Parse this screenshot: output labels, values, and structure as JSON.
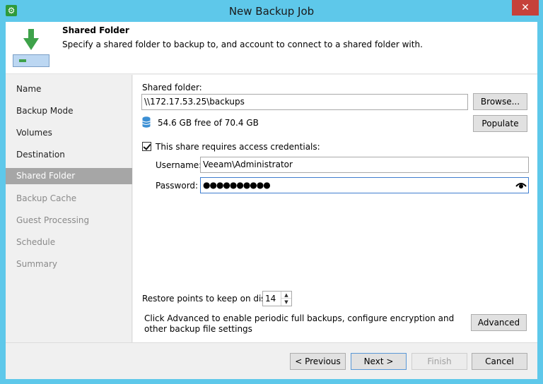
{
  "window": {
    "title": "New Backup Job",
    "close_glyph": "✕",
    "app_icon": "gear-icon"
  },
  "header": {
    "title": "Shared Folder",
    "description": "Specify a shared folder to backup to, and account to connect to a shared folder with."
  },
  "sidebar": {
    "items": [
      {
        "label": "Name",
        "state": "normal"
      },
      {
        "label": "Backup Mode",
        "state": "normal"
      },
      {
        "label": "Volumes",
        "state": "normal"
      },
      {
        "label": "Destination",
        "state": "normal"
      },
      {
        "label": "Shared Folder",
        "state": "active"
      },
      {
        "label": "Backup Cache",
        "state": "disabled"
      },
      {
        "label": "Guest Processing",
        "state": "disabled"
      },
      {
        "label": "Schedule",
        "state": "disabled"
      },
      {
        "label": "Summary",
        "state": "disabled"
      }
    ]
  },
  "main": {
    "shared_folder_label": "Shared folder:",
    "shared_folder_value": "\\\\172.17.53.25\\backups",
    "browse_label": "Browse...",
    "free_space_text": "54.6 GB free of 70.4 GB",
    "populate_label": "Populate",
    "credentials_checkbox_label": "This share requires access credentials:",
    "credentials_checked": true,
    "username_label": "Username:",
    "username_value": "Veeam\\Administrator",
    "password_label": "Password:",
    "password_value": "●●●●●●●●●●",
    "restore_points_label": "Restore points to keep on disk:",
    "restore_points_value": "14",
    "advanced_text": "Click Advanced to enable periodic full backups, configure encryption and other backup file settings",
    "advanced_label": "Advanced"
  },
  "footer": {
    "previous_label": "< Previous",
    "next_label": "Next >",
    "finish_label": "Finish",
    "cancel_label": "Cancel"
  },
  "colors": {
    "title_bar": "#5ec8ea",
    "close_button": "#c6413a",
    "active_nav": "#a6a6a6",
    "arrow_green": "#3ea24a"
  }
}
